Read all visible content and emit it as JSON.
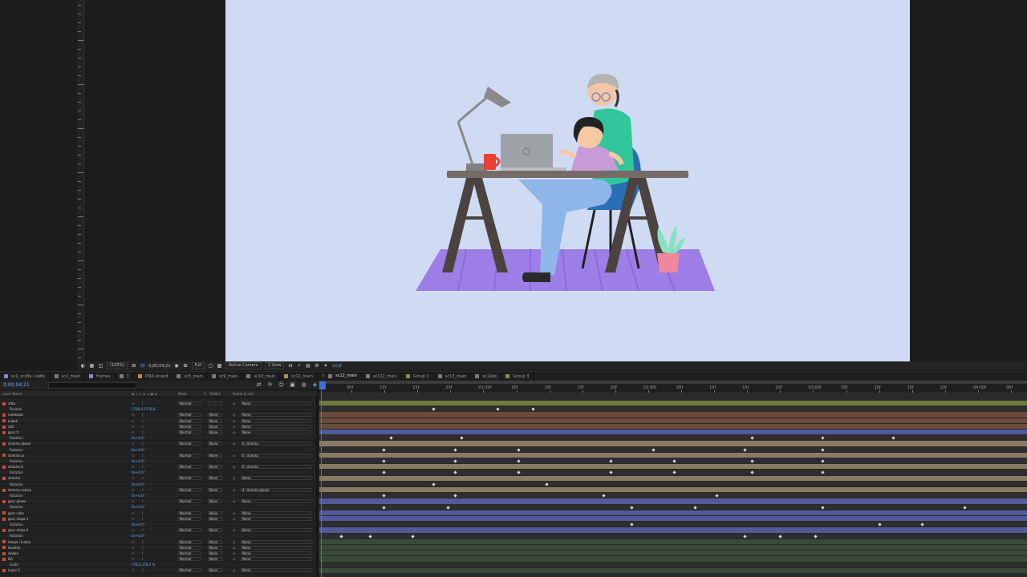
{
  "viewer": {
    "toolbar": {
      "zoom": "(100%)",
      "timecode": "0;00;04;21",
      "resolution": "Full",
      "camera": "Active Camera",
      "views": "1 View",
      "offset": "+0,0"
    }
  },
  "tabs": [
    {
      "label": "sc1_scsBa i w#ki",
      "color": "#7a8fbf",
      "active": false
    },
    {
      "label": "sc2_main",
      "color": "#7a7a7a",
      "active": false
    },
    {
      "label": "frames",
      "color": "#7a8fbf",
      "active": false
    },
    {
      "label": "3",
      "color": "#7a7a7a",
      "active": false
    },
    {
      "label": "DNA strand",
      "color": "#b58a5a",
      "active": false
    },
    {
      "label": "sc8_main",
      "color": "#7a7a7a",
      "active": false
    },
    {
      "label": "sc9_main",
      "color": "#7a7a7a",
      "active": false
    },
    {
      "label": "sc10_main",
      "color": "#7a7a7a",
      "active": false
    },
    {
      "label": "sc11_main",
      "color": "#b58a5a",
      "active": false
    },
    {
      "label": "sc12_main",
      "color": "#7a7a7a",
      "active": true
    },
    {
      "label": "sc122_main",
      "color": "#7a7a7a",
      "active": false
    },
    {
      "label": "Group 1",
      "color": "#8a8a5a",
      "active": false
    },
    {
      "label": "sc13_main",
      "color": "#7a7a7a",
      "active": false
    },
    {
      "label": "sc14ab",
      "color": "#7a7a7a",
      "active": false
    },
    {
      "label": "Group 3",
      "color": "#8a8a5a",
      "active": false
    }
  ],
  "timeline": {
    "current_time": "0;00;04;21",
    "columns": {
      "layer_name": "Layer Name",
      "mode": "Mode",
      "t": "T",
      "trkmat": "TrkMat",
      "parent": "Parent & Link"
    },
    "ruler_labels": [
      "05f",
      "10f",
      "15f",
      "20f",
      "01;00f",
      "05f",
      "10f",
      "15f",
      "20f",
      "02;00f",
      "05f",
      "10f",
      "15f",
      "20f",
      "03;00f",
      "05f",
      "10f",
      "15f",
      "20f",
      "04;00f",
      "05f"
    ],
    "rows": [
      {
        "type": "layer",
        "name": "zdka",
        "mode": "Normal",
        "trk": "",
        "parent": "None",
        "bar": "#6f7d3a",
        "kf": []
      },
      {
        "type": "prop",
        "name": "Position",
        "value": "1790,0,1370,8",
        "bar": "#2e2e2e",
        "kf": [
          0.16,
          0.25,
          0.3
        ]
      },
      {
        "type": "layer",
        "name": "notebook",
        "mode": "Normal",
        "trk": "None",
        "parent": "None",
        "bar": "#6a4a3a",
        "kf": []
      },
      {
        "type": "layer",
        "name": "kubek",
        "mode": "Normal",
        "trk": "None",
        "parent": "None",
        "bar": "#6a4a3a",
        "kf": []
      },
      {
        "type": "layer",
        "name": "stol",
        "mode": "Normal",
        "trk": "None",
        "parent": "None",
        "bar": "#6a4a3a",
        "kf": []
      },
      {
        "type": "layer",
        "name": "gosc lt",
        "mode": "Normal",
        "trk": "None",
        "parent": "None",
        "bar": "#525a9c",
        "kf": []
      },
      {
        "type": "prop",
        "name": "Rotation",
        "value": "0x+0,0°",
        "bar": "#2e2e2e",
        "kf": [
          0.1,
          0.2,
          0.61,
          0.71,
          0.81
        ]
      },
      {
        "type": "layer",
        "name": "dziecko glowa",
        "mode": "Normal",
        "trk": "None",
        "parent": "6. dziecko",
        "bar": "#8a7a62",
        "kf": []
      },
      {
        "type": "prop",
        "name": "Rotation",
        "value": "0x+0,0°",
        "bar": "#2e2e2e",
        "kf": [
          0.09,
          0.19,
          0.28,
          0.47,
          0.6,
          0.71
        ]
      },
      {
        "type": "layer",
        "name": "dziecko pr",
        "mode": "Normal",
        "trk": "None",
        "parent": "6. dziecko",
        "bar": "#8a7a62",
        "kf": []
      },
      {
        "type": "prop",
        "name": "Rotation",
        "value": "0x+0,0°",
        "bar": "#2e2e2e",
        "kf": [
          0.09,
          0.19,
          0.28,
          0.41,
          0.5,
          0.61,
          0.71
        ]
      },
      {
        "type": "layer",
        "name": "dziecko lt",
        "mode": "Normal",
        "trk": "None",
        "parent": "6. dziecko",
        "bar": "#8a7a62",
        "kf": []
      },
      {
        "type": "prop",
        "name": "Rotation",
        "value": "0x+0,0°",
        "bar": "#2e2e2e",
        "kf": [
          0.09,
          0.19,
          0.28,
          0.41,
          0.5,
          0.61,
          0.71
        ]
      },
      {
        "type": "layer",
        "name": "dziecko",
        "mode": "Normal",
        "trk": "None",
        "parent": "None",
        "bar": "#8a7a62",
        "kf": []
      },
      {
        "type": "prop",
        "name": "Rotation",
        "value": "0x+0,0°",
        "bar": "#2e2e2e",
        "kf": [
          0.16,
          0.32
        ]
      },
      {
        "type": "layer",
        "name": "dziecko sekcja",
        "mode": "Normal",
        "trk": "None",
        "parent": "4. dziecko glowa",
        "bar": "#8a7a62",
        "kf": []
      },
      {
        "type": "prop",
        "name": "Rotation",
        "value": "0x+0,0°",
        "bar": "#2e2e2e",
        "kf": [
          0.09,
          0.19,
          0.4,
          0.56
        ]
      },
      {
        "type": "layer",
        "name": "gosc glowa",
        "mode": "Normal",
        "trk": "None",
        "parent": "None",
        "bar": "#525a9c",
        "kf": []
      },
      {
        "type": "prop",
        "name": "Rotation",
        "value": "0x+0,0°",
        "bar": "#2e2e2e",
        "kf": [
          0.09,
          0.18,
          0.44,
          0.53,
          0.71,
          0.91
        ]
      },
      {
        "type": "layer",
        "name": "gosc cialo",
        "mode": "Normal",
        "trk": "None",
        "parent": "None",
        "bar": "#525a9c",
        "kf": []
      },
      {
        "type": "layer",
        "name": "gosc stopa 1",
        "mode": "Normal",
        "trk": "None",
        "parent": "None",
        "bar": "#525a9c",
        "kf": []
      },
      {
        "type": "prop",
        "name": "Rotation",
        "value": "0x+0,0°",
        "bar": "#2e2e2e",
        "kf": [
          0.44,
          0.79,
          0.85
        ]
      },
      {
        "type": "layer",
        "name": "gosc stopa 2",
        "mode": "Normal",
        "trk": "None",
        "parent": "None",
        "bar": "#525a9c",
        "kf": []
      },
      {
        "type": "prop",
        "name": "Rotation",
        "value": "0x+0,0°",
        "bar": "#2e2e2e",
        "kf": [
          0.03,
          0.07,
          0.13,
          0.6,
          0.65,
          0.7
        ]
      },
      {
        "type": "layer",
        "name": "lampa i kubek",
        "mode": "Normal",
        "trk": "None",
        "parent": "None",
        "bar": "#394a39",
        "kf": []
      },
      {
        "type": "layer",
        "name": "kwiatek",
        "mode": "Normal",
        "trk": "None",
        "parent": "None",
        "bar": "#394a39",
        "kf": []
      },
      {
        "type": "layer",
        "name": "dywan",
        "mode": "Normal",
        "trk": "None",
        "parent": "None",
        "bar": "#394a39",
        "kf": []
      },
      {
        "type": "layer",
        "name": "BG",
        "mode": "Normal",
        "trk": "None",
        "parent": "None",
        "bar": "#394a39",
        "kf": []
      },
      {
        "type": "prop",
        "name": "Scale",
        "value": "178,0,178,0 %",
        "bar": "#2e2e2e",
        "kf": []
      },
      {
        "type": "layer",
        "name": "Layer 2",
        "mode": "Normal",
        "trk": "None",
        "parent": "None",
        "bar": "#394a39",
        "kf": []
      }
    ]
  },
  "colors": {
    "canvas_bg": "#cfdbf3",
    "accent": "#3a6fd8",
    "playhead": "#e0443a"
  }
}
